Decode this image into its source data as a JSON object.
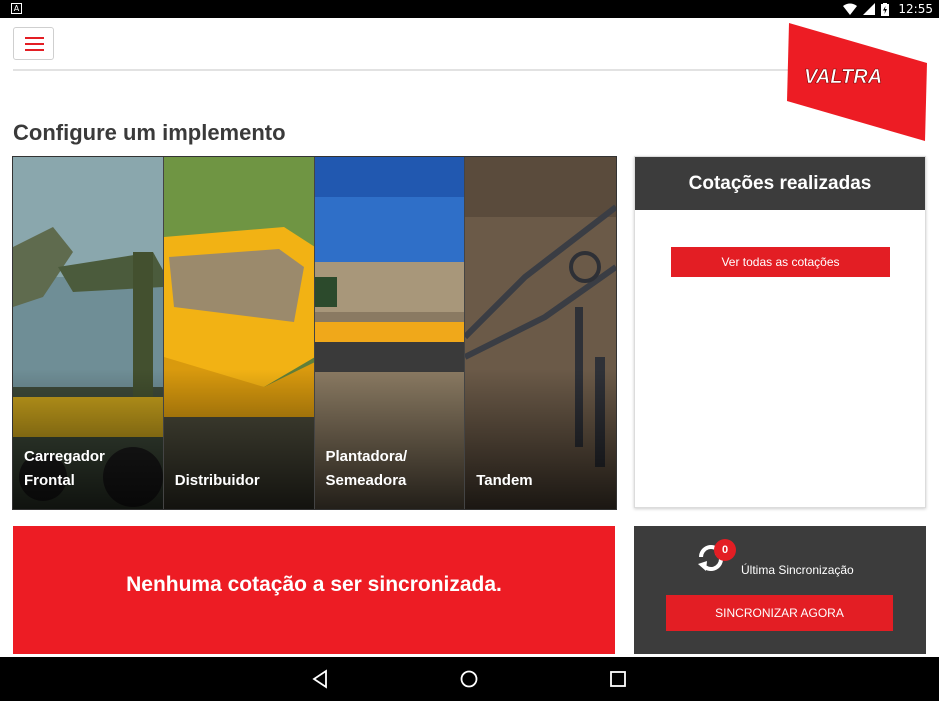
{
  "status_bar": {
    "app_icon_letter": "A",
    "time": "12:55"
  },
  "header": {
    "logo_text": "VALTRA"
  },
  "page_title": "Configure um implemento",
  "implements": [
    {
      "label": "Carregador\nFrontal"
    },
    {
      "label": "Distribuidor"
    },
    {
      "label": "Plantadora/\nSemeadora"
    },
    {
      "label": "Tandem"
    }
  ],
  "quotes_panel": {
    "title": "Cotações realizadas",
    "view_all_label": "Ver todas as cotações"
  },
  "sync_banner": {
    "message": "Nenhuma cotação a ser sincronizada."
  },
  "sync_panel": {
    "badge_count": "0",
    "last_sync_label": "Última Sincronização",
    "sync_now_label": "SINCRONIZAR AGORA"
  },
  "colors": {
    "accent_red": "#e31e24",
    "dark_panel": "#3c3c3c"
  }
}
